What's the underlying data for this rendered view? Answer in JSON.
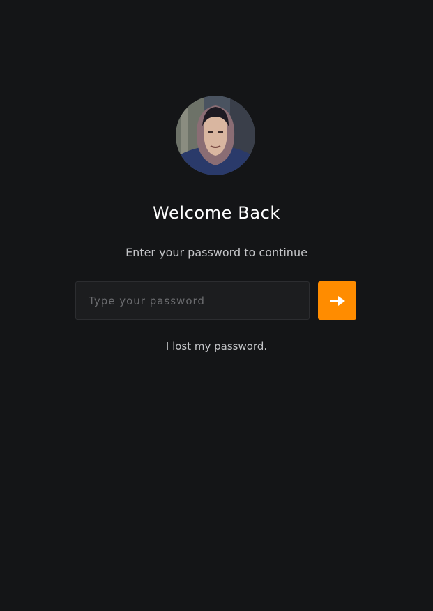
{
  "login": {
    "avatar_icon": "user-avatar-photo",
    "title": "Welcome Back",
    "subtitle": "Enter your password to continue",
    "password_placeholder": "Type your password",
    "submit_icon": "arrow-right-icon",
    "lost_password_link": "I lost my password."
  },
  "colors": {
    "background": "#141517",
    "input_background": "#1c1d1f",
    "accent": "#ff8c00",
    "text_primary": "#ffffff",
    "text_secondary": "#c4c5c8"
  }
}
